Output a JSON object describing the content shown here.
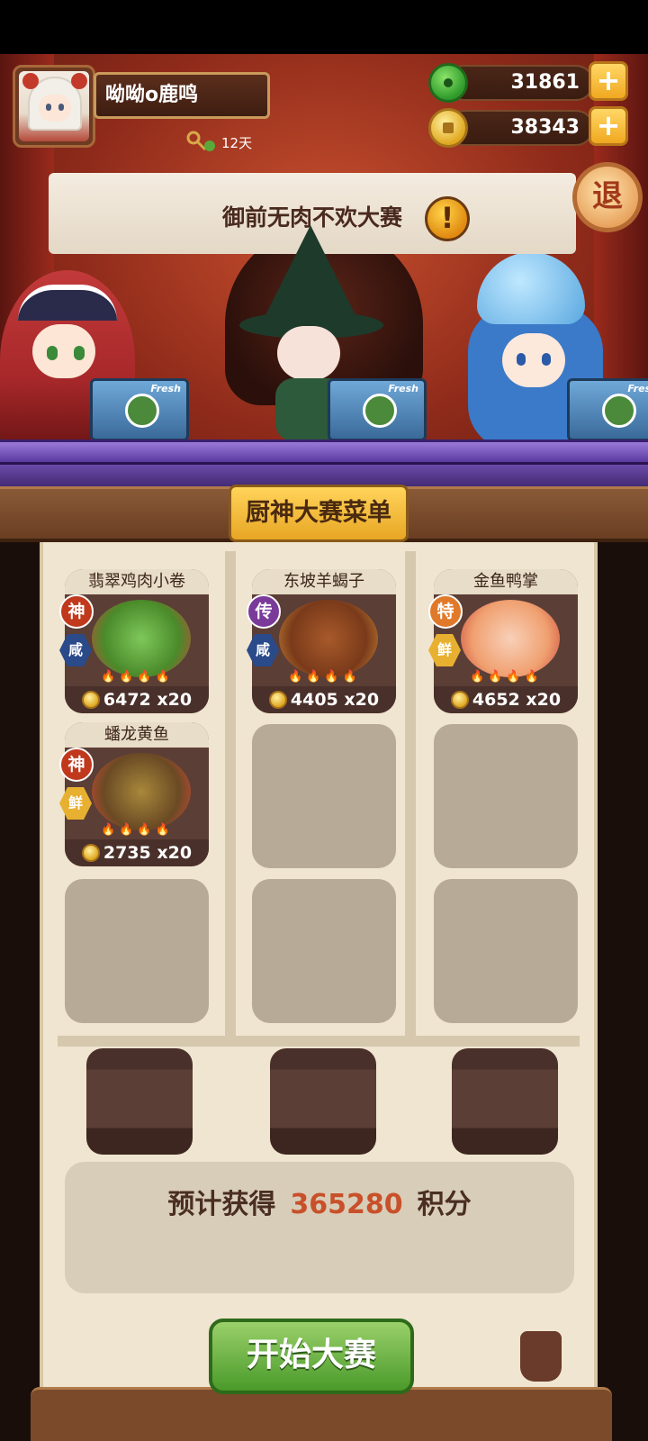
{
  "player": {
    "name": "呦呦o鹿鸣",
    "days": "12天"
  },
  "currency": {
    "jade": "31861",
    "coins": "38343",
    "plus": "+"
  },
  "event": {
    "banner_title": "御前无肉不欢大赛",
    "alert": "!",
    "exit_label": "退"
  },
  "stage": {
    "box_label": "Fresh"
  },
  "menu": {
    "title": "厨神大赛菜单",
    "dishes": [
      {
        "name": "翡翠鸡肉小卷",
        "rank": "神",
        "taste": "咸",
        "price": "6472",
        "qty": "x20",
        "rank_color": "#c0391c",
        "taste_color": "#2a4a8a",
        "food_color": "#6fbf4a"
      },
      {
        "name": "东坡羊蝎子",
        "rank": "传",
        "taste": "咸",
        "price": "4405",
        "qty": "x20",
        "rank_color": "#7a3a9a",
        "taste_color": "#2a4a8a",
        "food_color": "#8a4a24"
      },
      {
        "name": "金鱼鸭掌",
        "rank": "特",
        "taste": "鲜",
        "price": "4652",
        "qty": "x20",
        "rank_color": "#e07a2a",
        "taste_color": "#e8b030",
        "food_color": "#f0a070"
      },
      {
        "name": "蟠龙黄鱼",
        "rank": "神",
        "taste": "鲜",
        "price": "2735",
        "qty": "x20",
        "rank_color": "#c0391c",
        "taste_color": "#e8b030",
        "food_color": "#8a6a3a"
      }
    ],
    "fires": "🔥🔥🔥🔥"
  },
  "estimate": {
    "prefix": "预计获得",
    "value": "365280",
    "suffix": "积分"
  },
  "start_button": "开始大赛"
}
